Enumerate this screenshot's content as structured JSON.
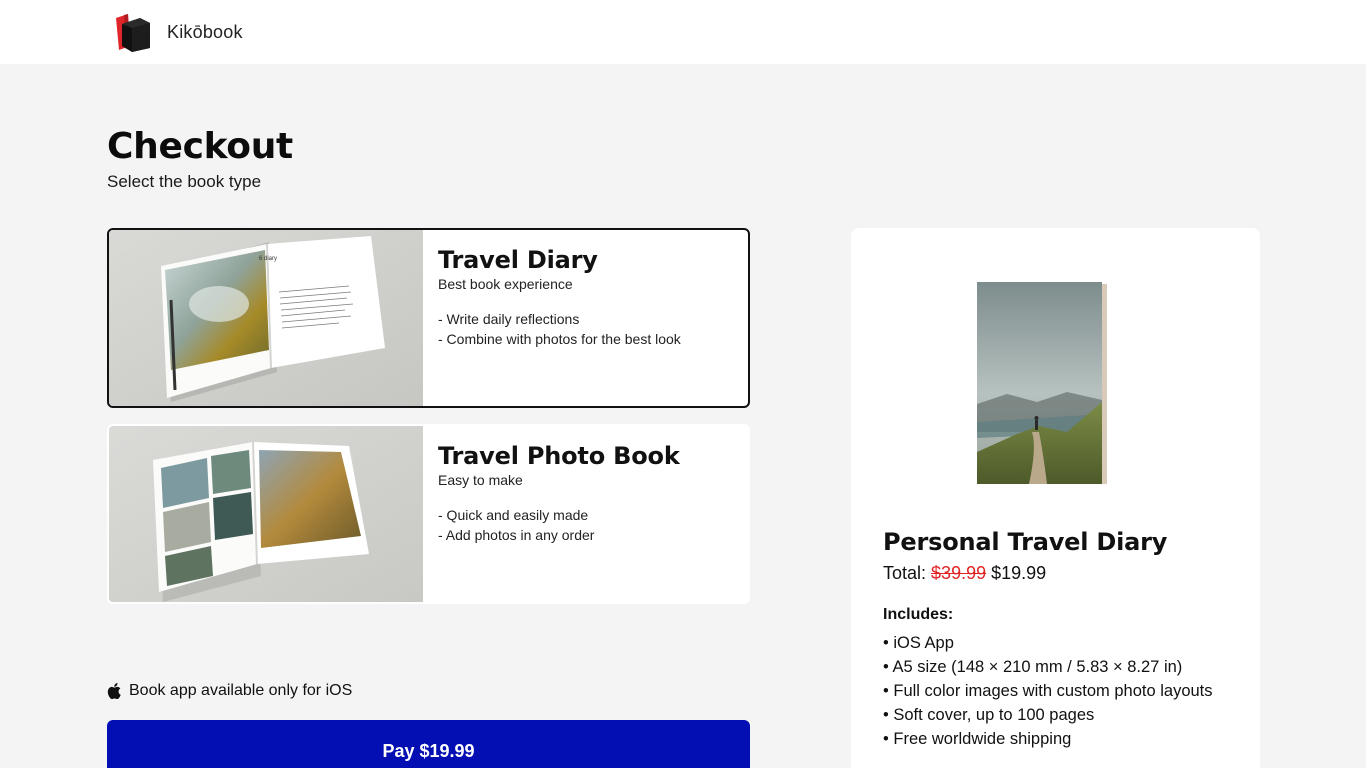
{
  "brand": {
    "name": "Kikōbook",
    "logo_icon": "books-logo-icon"
  },
  "checkout": {
    "title": "Checkout",
    "subtitle": "Select the book type"
  },
  "options": [
    {
      "title": "Travel Diary",
      "subtitle": "Best book experience",
      "features": [
        "- Write daily reflections",
        "- Combine with photos for the best look"
      ],
      "selected": true,
      "image_icon": "open-diary-photo"
    },
    {
      "title": "Travel Photo Book",
      "subtitle": "Easy to make",
      "features": [
        "- Quick and easily made",
        "- Add photos in any order"
      ],
      "selected": false,
      "image_icon": "open-photobook-photo"
    }
  ],
  "ios_note": {
    "text": "Book app available only for iOS",
    "icon": "apple-icon"
  },
  "pay_button": {
    "label": "Pay $19.99"
  },
  "summary": {
    "cover_image": "book-cover-mountain-hiker",
    "title": "Personal Travel Diary",
    "total_label": "Total:",
    "old_price": "$39.99",
    "new_price": "$19.99",
    "includes_label": "Includes:",
    "includes": [
      "iOS App",
      "A5 size (148 × 210 mm / 5.83 × 8.27 in)",
      "Full color images with custom photo layouts",
      "Soft cover, up to 100 pages",
      "Free worldwide shipping"
    ]
  },
  "colors": {
    "page_bg": "#f4f4f4",
    "pay_button": "#040fb3",
    "strike_price": "#e02424",
    "selected_border": "#111111"
  }
}
